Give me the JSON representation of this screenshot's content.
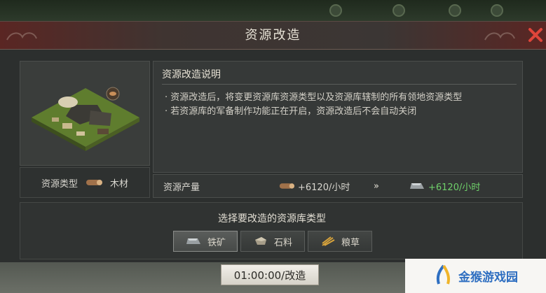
{
  "dialog": {
    "title": "资源改造",
    "close_icon": "close-icon"
  },
  "resource": {
    "type_label": "资源类型",
    "type_value": "木材",
    "type_icon": "wood-log-icon"
  },
  "description": {
    "title": "资源改造说明",
    "bullets": [
      "· 资源改造后，将变更资源库资源类型以及资源库辖制的所有领地资源类型",
      "· 若资源库的军备制作功能正在开启，资源改造后不会自动关闭"
    ]
  },
  "output": {
    "label": "资源产量",
    "current": "+6120/小时",
    "arrow": "»",
    "new": "+6120/小时",
    "new_color": "#6fd06a"
  },
  "choose": {
    "label": "选择要改造的资源库类型",
    "options": [
      {
        "label": "铁矿",
        "icon": "iron-ingot-icon",
        "selected": true
      },
      {
        "label": "石料",
        "icon": "stone-icon",
        "selected": false
      },
      {
        "label": "粮草",
        "icon": "grain-icon",
        "selected": false
      }
    ]
  },
  "action": {
    "upgrade_label": "01:00:00/改造"
  }
}
